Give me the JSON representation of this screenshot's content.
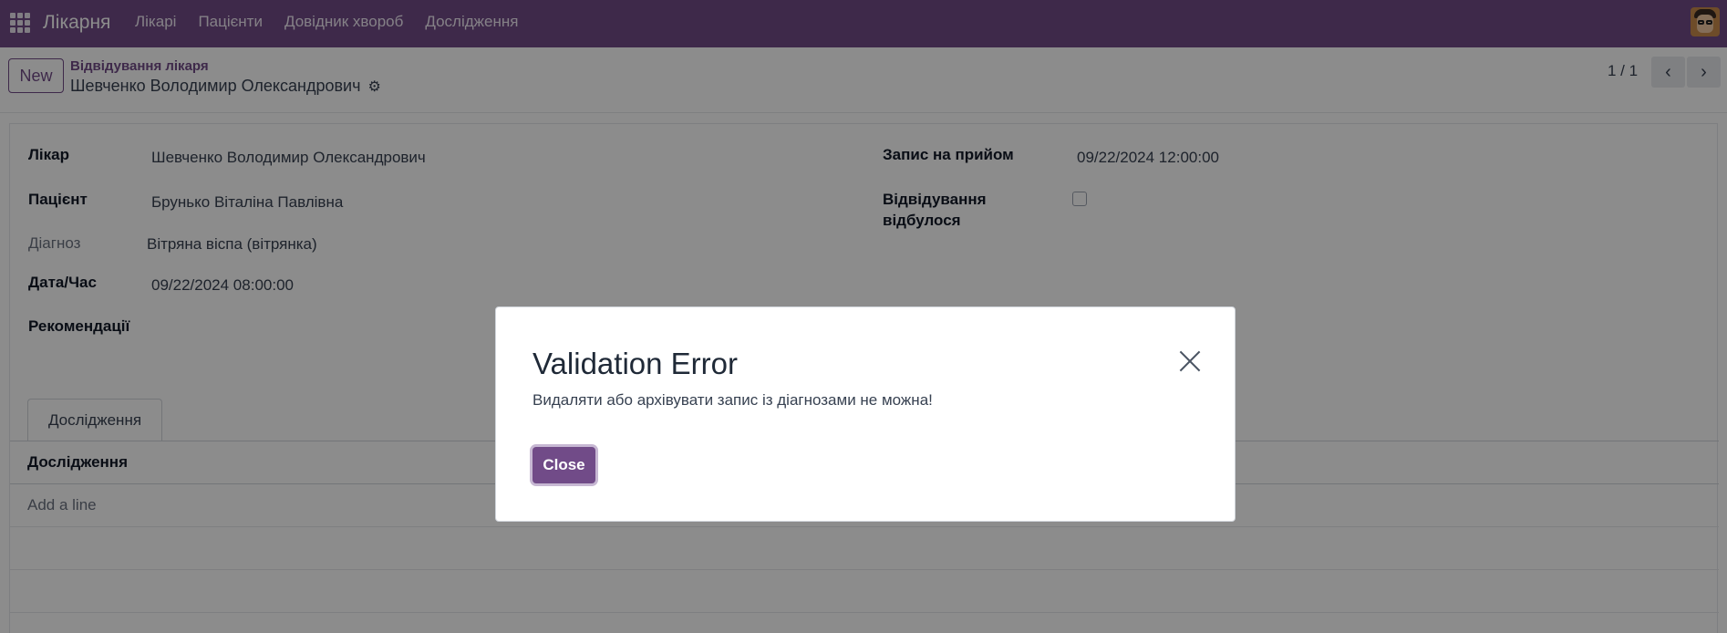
{
  "navbar": {
    "brand": "Лікарня",
    "menu": [
      "Лікарі",
      "Пацієнти",
      "Довідник хвороб",
      "Дослідження"
    ]
  },
  "control": {
    "new_label": "New",
    "breadcrumb_parent": "Відвідування лікаря",
    "breadcrumb_current": "Шевченко Володимир Олександрович",
    "pager": "1 / 1"
  },
  "form": {
    "doctor_label": "Лікар",
    "doctor_value": "Шевченко Володимир Олександрович",
    "patient_label": "Пацієнт",
    "patient_value": "Брунько Віталіна Павлівна",
    "diagnosis_label": "Діагноз",
    "diagnosis_value": "Вітряна віспа (вітрянка)",
    "datetime_label": "Дата/Час",
    "datetime_value": "09/22/2024 08:00:00",
    "recommendations_label": "Рекомендації",
    "appointment_label": "Запис на прийом",
    "appointment_value": "09/22/2024 12:00:00",
    "visit_done_label_1": "Відвідування",
    "visit_done_label_2": "відбулося",
    "visit_done_checked": false
  },
  "tabs": {
    "active": "Дослідження",
    "list_header": "Дослідження",
    "add_line": "Add a line"
  },
  "dialog": {
    "title": "Validation Error",
    "message": "Видаляти або архівувати запис із діагнозами не можна!",
    "close_label": "Close"
  },
  "colors": {
    "brand": "#714b88",
    "overlay": "rgba(0,0,0,0.45)"
  }
}
